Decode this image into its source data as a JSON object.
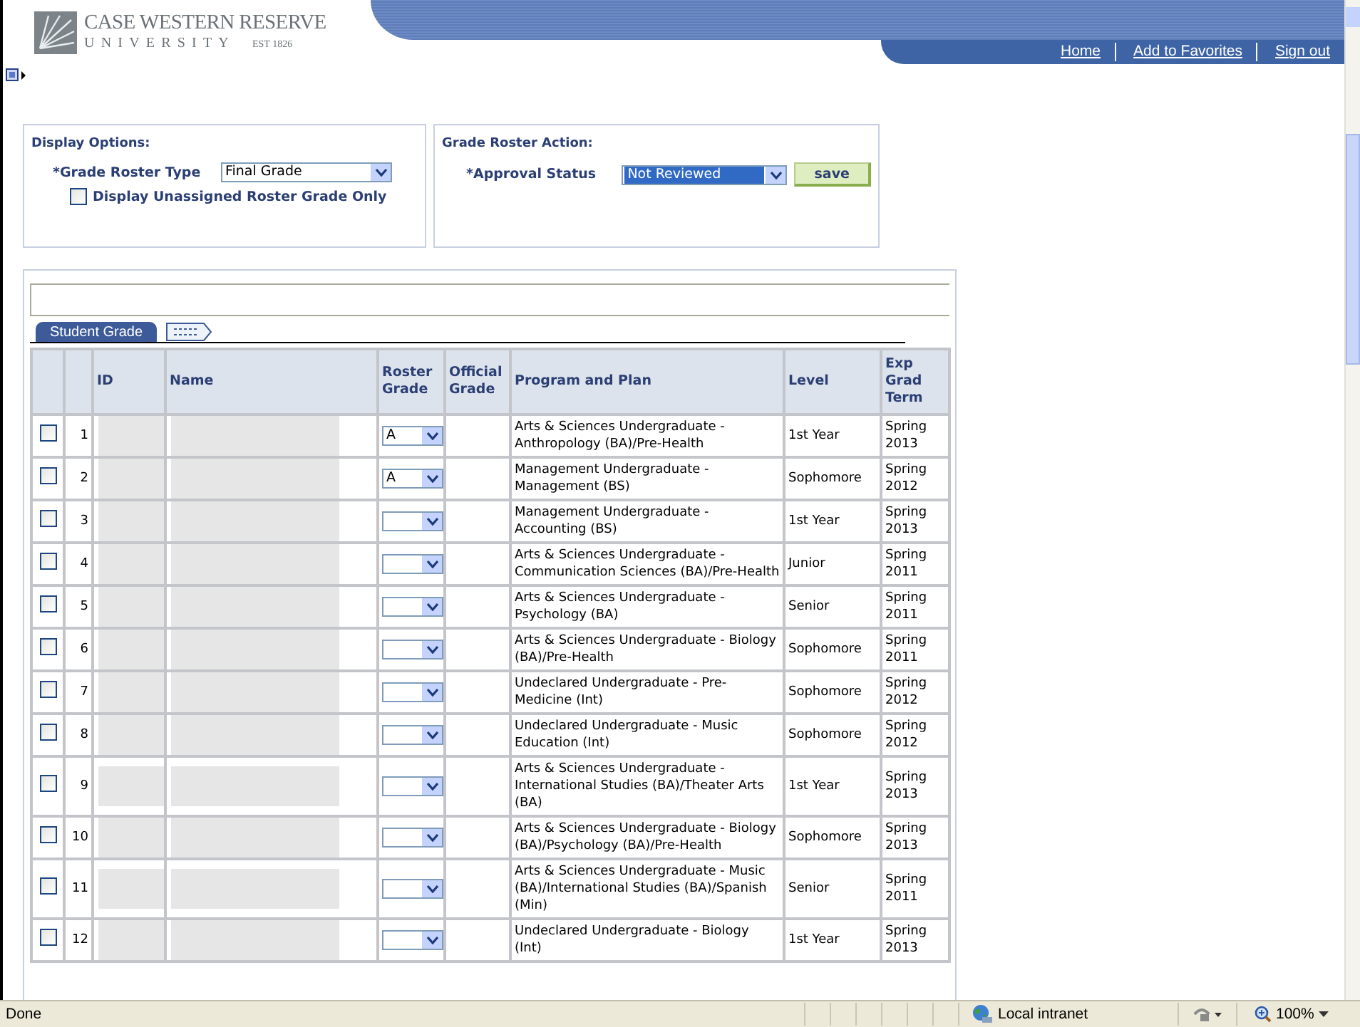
{
  "header": {
    "logo": {
      "name": "CASE WESTERN RESERVE",
      "sub": "UNIVERSITY",
      "est": "EST 1826"
    },
    "nav_links": [
      "Home",
      "Add to Favorites",
      "Sign out"
    ]
  },
  "display_options": {
    "title": "Display Options:",
    "grade_roster_type": {
      "label": "*Grade Roster Type",
      "value": "Final Grade"
    },
    "unassigned_only": {
      "label": "Display Unassigned Roster Grade Only",
      "checked": false
    }
  },
  "grade_roster_action": {
    "title": "Grade Roster Action:",
    "approval_status": {
      "label": "*Approval Status",
      "value": "Not Reviewed"
    },
    "save_button": "save"
  },
  "grid": {
    "tabs": [
      {
        "label": "Student Grade",
        "selected": true
      }
    ],
    "columns": [
      "ID",
      "Name",
      "Roster Grade",
      "Official Grade",
      "Program and Plan",
      "Level",
      "Exp Grad Term"
    ],
    "rows": [
      {
        "number": "1",
        "checked": false,
        "roster_grade": "A",
        "program": "Arts & Sciences Undergraduate - Anthropology (BA)/Pre-Health",
        "level": "1st Year",
        "term": "Spring 2013"
      },
      {
        "number": "2",
        "checked": false,
        "roster_grade": "A",
        "program": "Management Undergraduate - Management (BS)",
        "level": "Sophomore",
        "term": "Spring 2012"
      },
      {
        "number": "3",
        "checked": false,
        "program": "Management Undergraduate - Accounting (BS)",
        "level": "1st Year",
        "term": "Spring 2013"
      },
      {
        "number": "4",
        "checked": false,
        "program": "Arts & Sciences Undergraduate - Communication Sciences (BA)/Pre-Health",
        "level": "Junior",
        "term": "Spring 2011"
      },
      {
        "number": "5",
        "checked": false,
        "program": "Arts & Sciences Undergraduate - Psychology (BA)",
        "level": "Senior",
        "term": "Spring 2011"
      },
      {
        "number": "6",
        "checked": false,
        "program": "Arts & Sciences Undergraduate - Biology (BA)/Pre-Health",
        "level": "Sophomore",
        "term": "Spring 2011"
      },
      {
        "number": "7",
        "checked": false,
        "program": "Undeclared Undergraduate - Pre-Medicine (Int)",
        "level": "Sophomore",
        "term": "Spring 2012"
      },
      {
        "number": "8",
        "checked": false,
        "program": "Undeclared Undergraduate - Music Education (Int)",
        "level": "Sophomore",
        "term": "Spring 2012"
      },
      {
        "number": "9",
        "checked": false,
        "program": "Arts & Sciences Undergraduate - International Studies (BA)/Theater Arts (BA)",
        "level": "1st Year",
        "term": "Spring 2013"
      },
      {
        "number": "10",
        "checked": false,
        "program": "Arts & Sciences Undergraduate - Biology (BA)/Psychology (BA)/Pre-Health",
        "level": "Sophomore",
        "term": "Spring 2013"
      },
      {
        "number": "11",
        "checked": false,
        "program": "Arts & Sciences Undergraduate - Music (BA)/International Studies (BA)/Spanish (Min)",
        "level": "Senior",
        "term": "Spring 2011"
      },
      {
        "number": "12",
        "checked": false,
        "program": "Undeclared Undergraduate - Biology (Int)",
        "level": "1st Year",
        "term": "Spring 2013"
      }
    ]
  },
  "status_bar": {
    "status": "Done",
    "zone": "Local intranet",
    "zoom": "100%"
  }
}
